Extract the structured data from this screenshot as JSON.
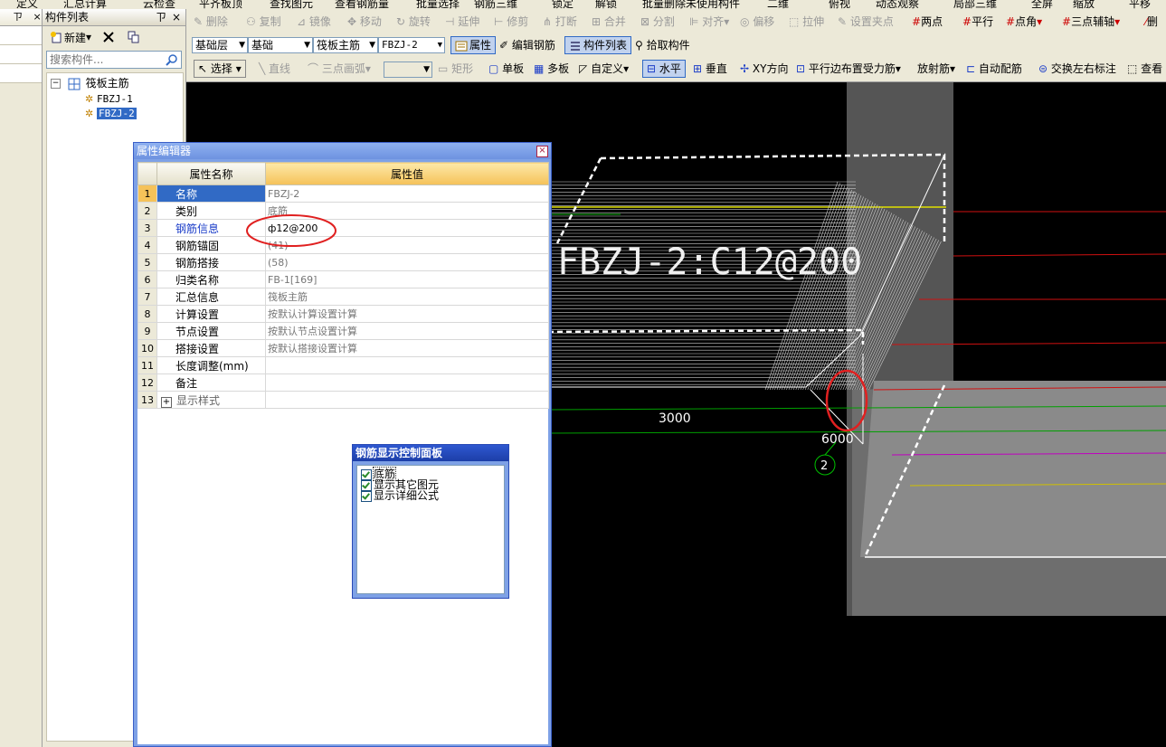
{
  "top_strip": [
    "定义",
    "汇总计算",
    "云检查",
    "平齐板顶",
    "查找图元",
    "查看钢筋量",
    "批量选择",
    "钢筋三维",
    "锁定",
    "解锁",
    "批量删除未使用构件",
    "二维",
    "俯视",
    "动态观察",
    "局部三维",
    "全屏",
    "缩放",
    "平移"
  ],
  "left_nav": {
    "pin": "ㄗ",
    "close": "×"
  },
  "component_panel": {
    "title": "构件列表",
    "pin": "ㄗ",
    "close": "×",
    "new_button": "新建",
    "search_placeholder": "搜索构件...",
    "tree_root": "筏板主筋",
    "tree_items": [
      "FBZJ-1",
      "FBZJ-2"
    ]
  },
  "toolbar_row1": {
    "items": [
      "删除",
      "复制",
      "镜像",
      "移动",
      "旋转",
      "延伸",
      "修剪",
      "打断",
      "合并",
      "分割",
      "对齐",
      "偏移",
      "拉伸",
      "设置夹点"
    ],
    "right_items": [
      "两点",
      "平行",
      "点角",
      "三点辅轴",
      "删"
    ]
  },
  "toolbar_row2": {
    "floor": "基础层",
    "category": "基础",
    "type": "筏板主筋",
    "component": "FBZJ-2",
    "property_button": "属性",
    "edit_rebar_button": "编辑钢筋",
    "component_list_button": "构件列表",
    "pick_button": "拾取构件"
  },
  "toolbar_row3": {
    "select": "选择",
    "line": "直线",
    "arc": "三点画弧",
    "rect": "矩形",
    "single_board": "单板",
    "multi_board": "多板",
    "custom": "自定义",
    "horizontal": "水平",
    "vertical": "垂直",
    "xy": "XY方向",
    "parallel_edge": "平行边布置受力筋",
    "radial": "放射筋",
    "auto": "自动配筋",
    "swap_label": "交换左右标注",
    "view": "查看"
  },
  "property_editor": {
    "title": "属性编辑器",
    "col_name": "属性名称",
    "col_value": "属性值",
    "rows": [
      {
        "idx": "1",
        "name": "名称",
        "value": "FBZJ-2"
      },
      {
        "idx": "2",
        "name": "类别",
        "value": "底筋"
      },
      {
        "idx": "3",
        "name": "钢筋信息",
        "value": "ф12@200"
      },
      {
        "idx": "4",
        "name": "钢筋锚固",
        "value": "(41)"
      },
      {
        "idx": "5",
        "name": "钢筋搭接",
        "value": "(58)"
      },
      {
        "idx": "6",
        "name": "归类名称",
        "value": "FB-1[169]"
      },
      {
        "idx": "7",
        "name": "汇总信息",
        "value": "筏板主筋"
      },
      {
        "idx": "8",
        "name": "计算设置",
        "value": "按默认计算设置计算"
      },
      {
        "idx": "9",
        "name": "节点设置",
        "value": "按默认节点设置计算"
      },
      {
        "idx": "10",
        "name": "搭接设置",
        "value": "按默认搭接设置计算"
      },
      {
        "idx": "11",
        "name": "长度调整(mm)",
        "value": ""
      },
      {
        "idx": "12",
        "name": "备注",
        "value": ""
      },
      {
        "idx": "13",
        "name": "显示样式",
        "value": "",
        "expander": "+"
      }
    ]
  },
  "rebar_panel": {
    "title": "钢筋显示控制面板",
    "items": [
      "底筋",
      "显示其它图元",
      "显示详细公式"
    ]
  },
  "canvas": {
    "rebar_label": "FBZJ-2:C12@200",
    "dim_3000": "3000",
    "dim_6000": "6000",
    "axis_number": "2"
  },
  "colors": {
    "selection": "#316ac5",
    "header_value": "#f5c259",
    "highlight_circle": "#e02020",
    "canvas_bg": "#000000"
  }
}
